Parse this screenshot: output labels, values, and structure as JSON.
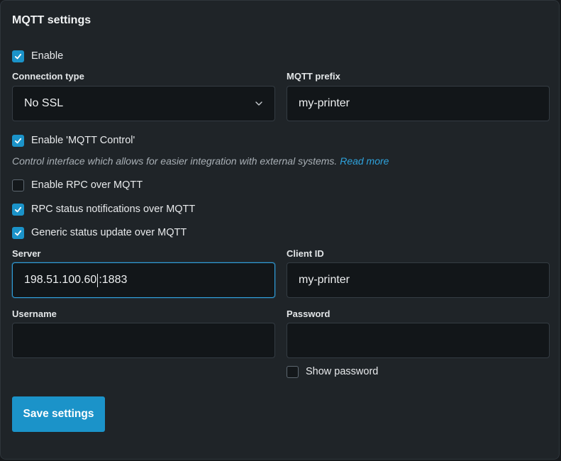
{
  "title": "MQTT settings",
  "enable": {
    "label": "Enable",
    "checked": true
  },
  "connection_type": {
    "label": "Connection type",
    "value": "No SSL"
  },
  "mqtt_prefix": {
    "label": "MQTT prefix",
    "value": "my-printer"
  },
  "mqtt_control": {
    "label": "Enable 'MQTT Control'",
    "checked": true,
    "hint": "Control interface which allows for easier integration with external systems.",
    "link": "Read more"
  },
  "rpc_over_mqtt": {
    "label": "Enable RPC over MQTT",
    "checked": false
  },
  "rpc_status": {
    "label": "RPC status notifications over MQTT",
    "checked": true
  },
  "generic_status": {
    "label": "Generic status update over MQTT",
    "checked": true
  },
  "server": {
    "label": "Server",
    "value_before_caret": "198.51.100.60",
    "value_after_caret": ":1883"
  },
  "client_id": {
    "label": "Client ID",
    "value": "my-printer"
  },
  "username": {
    "label": "Username",
    "value": ""
  },
  "password": {
    "label": "Password",
    "value": ""
  },
  "show_password": {
    "label": "Show password",
    "checked": false
  },
  "save_button": {
    "label": "Save settings"
  },
  "colors": {
    "accent": "#1b93c9",
    "panel": "#1f2428",
    "input_bg": "#121619",
    "link": "#2ea3dd"
  },
  "icons": {
    "check": "check-icon",
    "select": "chevron-down-icon"
  }
}
